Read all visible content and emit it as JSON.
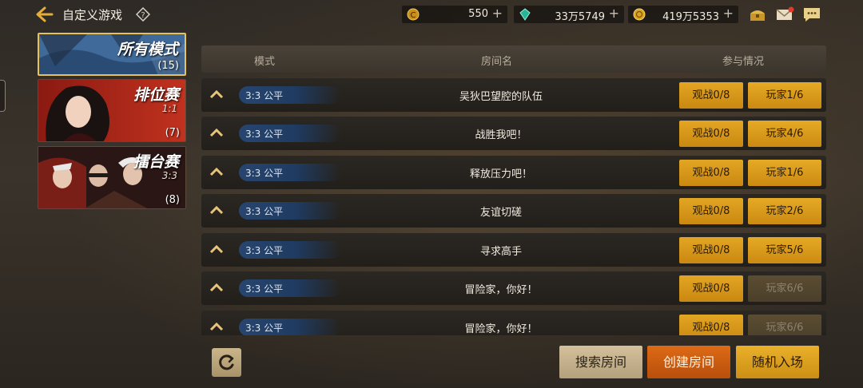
{
  "header": {
    "back_icon": "back-arrow-icon",
    "title": "自定义游戏",
    "help_icon": "question-mark-icon"
  },
  "currencies": [
    {
      "icon": "gold-coin-c-icon",
      "value": "550",
      "plus": "+"
    },
    {
      "icon": "green-crystal-icon",
      "value": "33万5749",
      "plus": "+"
    },
    {
      "icon": "gold-coin-icon",
      "value": "419万5353",
      "plus": "+"
    }
  ],
  "top_icons": [
    "chest-icon",
    "mail-icon",
    "chat-icon"
  ],
  "modes": [
    {
      "title": "所有模式",
      "sub": "",
      "count": "(15)",
      "selected": true
    },
    {
      "title": "排位赛",
      "sub": "1:1",
      "count": "(7)",
      "selected": false
    },
    {
      "title": "擂台赛",
      "sub": "3:3",
      "count": "(8)",
      "selected": false
    }
  ],
  "table": {
    "headers": {
      "mode": "模式",
      "room": "房间名",
      "status": "参与情况"
    },
    "rows": [
      {
        "mode": "3:3 公平",
        "name": "吴狄巴望腔的队伍",
        "watch": "观战0/8",
        "play": "玩家1/6",
        "full": false
      },
      {
        "mode": "3:3 公平",
        "name": "战胜我吧！",
        "watch": "观战0/8",
        "play": "玩家4/6",
        "full": false
      },
      {
        "mode": "3:3 公平",
        "name": "释放压力吧！",
        "watch": "观战0/8",
        "play": "玩家1/6",
        "full": false
      },
      {
        "mode": "3:3 公平",
        "name": "友谊切磋",
        "watch": "观战0/8",
        "play": "玩家2/6",
        "full": false
      },
      {
        "mode": "3:3 公平",
        "name": "寻求高手",
        "watch": "观战0/8",
        "play": "玩家5/6",
        "full": false
      },
      {
        "mode": "3:3 公平",
        "name": "冒险家，你好！",
        "watch": "观战0/8",
        "play": "玩家6/6",
        "full": true
      },
      {
        "mode": "3:3 公平",
        "name": "冒险家，你好！",
        "watch": "观战0/8",
        "play": "玩家6/6",
        "full": true
      }
    ]
  },
  "footer": {
    "refresh_icon": "refresh-icon",
    "search": "搜索房间",
    "create": "创建房间",
    "random": "随机入场"
  },
  "colors": {
    "accent_gold": "#e3a623",
    "create_orange": "#dd6a16",
    "pill_blue": "#27456f"
  }
}
